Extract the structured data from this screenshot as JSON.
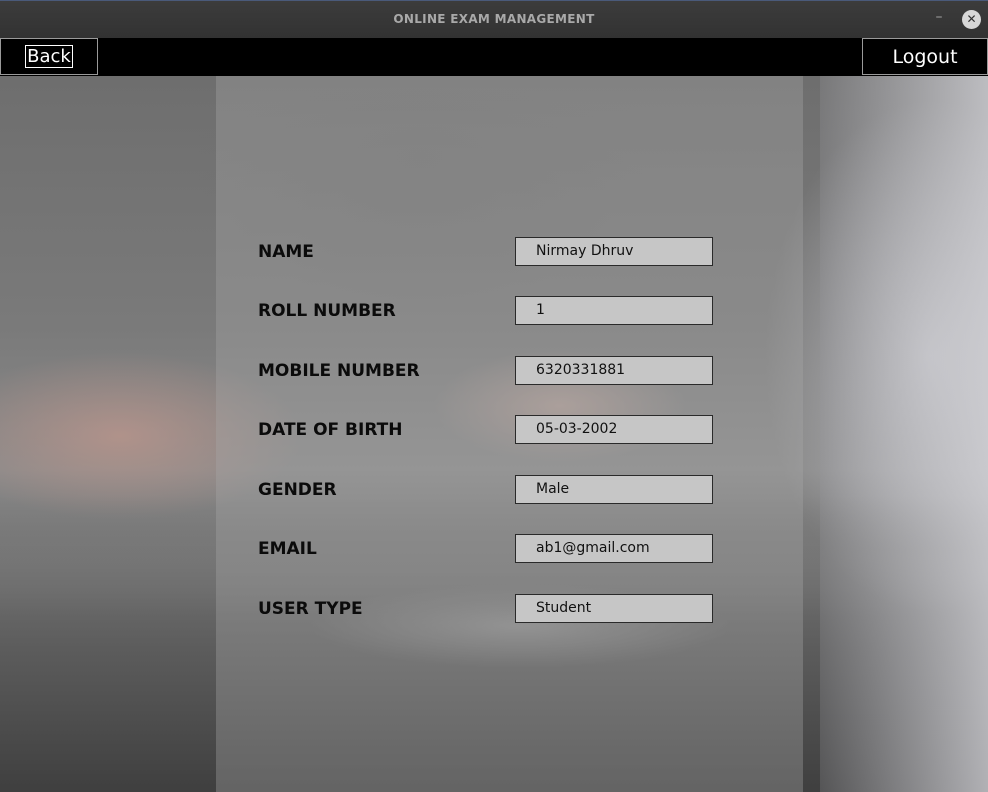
{
  "window": {
    "title": "ONLINE EXAM MANAGEMENT",
    "minimize_glyph": "–",
    "close_glyph": "✕"
  },
  "menubar": {
    "back_label": "Back",
    "logout_label": "Logout"
  },
  "profile": {
    "fields": [
      {
        "label": "NAME",
        "value": "Nirmay Dhruv"
      },
      {
        "label": "ROLL NUMBER",
        "value": "1"
      },
      {
        "label": "MOBILE NUMBER",
        "value": "6320331881"
      },
      {
        "label": "DATE OF BIRTH",
        "value": "05-03-2002"
      },
      {
        "label": "GENDER",
        "value": "Male"
      },
      {
        "label": "EMAIL",
        "value": "ab1@gmail.com"
      },
      {
        "label": "USER TYPE",
        "value": "Student"
      }
    ]
  },
  "colors": {
    "menubar_bg": "#000000",
    "field_bg": "#c6c6c6",
    "label_text": "#0b0b0b"
  }
}
